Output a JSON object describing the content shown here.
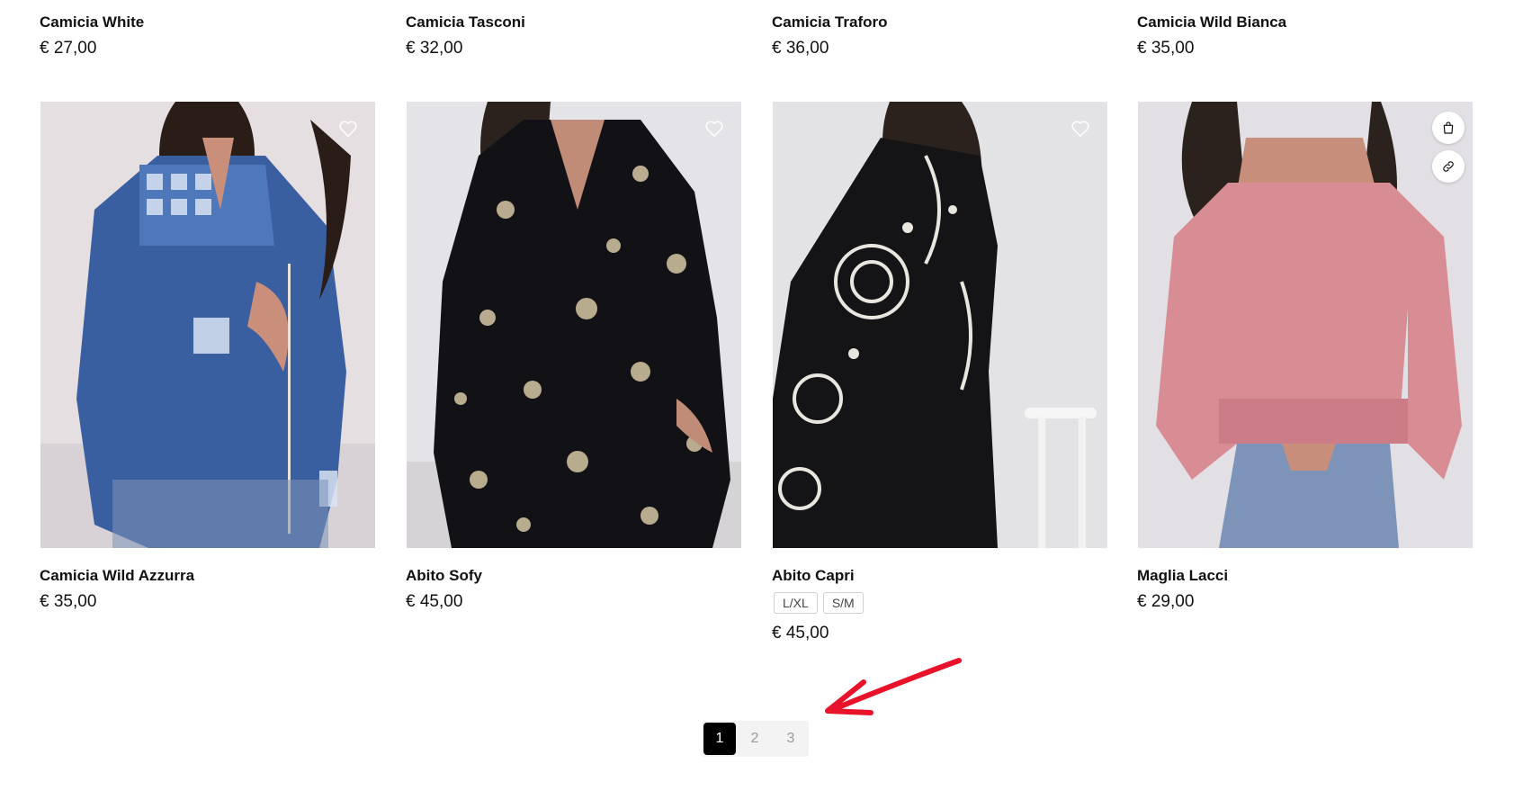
{
  "top_row": [
    {
      "name": "Camicia White",
      "price": "€ 27,00"
    },
    {
      "name": "Camicia Tasconi",
      "price": "€ 32,00"
    },
    {
      "name": "Camicia Traforo",
      "price": "€ 36,00"
    },
    {
      "name": "Camicia Wild Bianca",
      "price": "€ 35,00"
    }
  ],
  "products": [
    {
      "name": "Camicia Wild Azzurra",
      "price": "€ 35,00",
      "image_icon": "blue-embroidered-shirt-photo",
      "wishlist_icon": "heart-icon"
    },
    {
      "name": "Abito Sofy",
      "price": "€ 45,00",
      "image_icon": "black-floral-dress-photo",
      "wishlist_icon": "heart-icon"
    },
    {
      "name": "Abito Capri",
      "price": "€ 45,00",
      "sizes": [
        "L/XL",
        "S/M"
      ],
      "image_icon": "black-embroidered-dress-photo",
      "wishlist_icon": "heart-icon"
    },
    {
      "name": "Maglia Lacci",
      "price": "€ 29,00",
      "image_icon": "pink-top-photo",
      "actions": [
        "shopping-bag-icon",
        "link-icon"
      ]
    }
  ],
  "pagination": {
    "pages": [
      "1",
      "2",
      "3"
    ],
    "current": "1"
  },
  "annotation": {
    "arrow_color": "#e8122a",
    "points_to": "pagination"
  },
  "colors": {
    "text": "#111111",
    "accent": "#000000",
    "muted": "#9a9a9a"
  }
}
